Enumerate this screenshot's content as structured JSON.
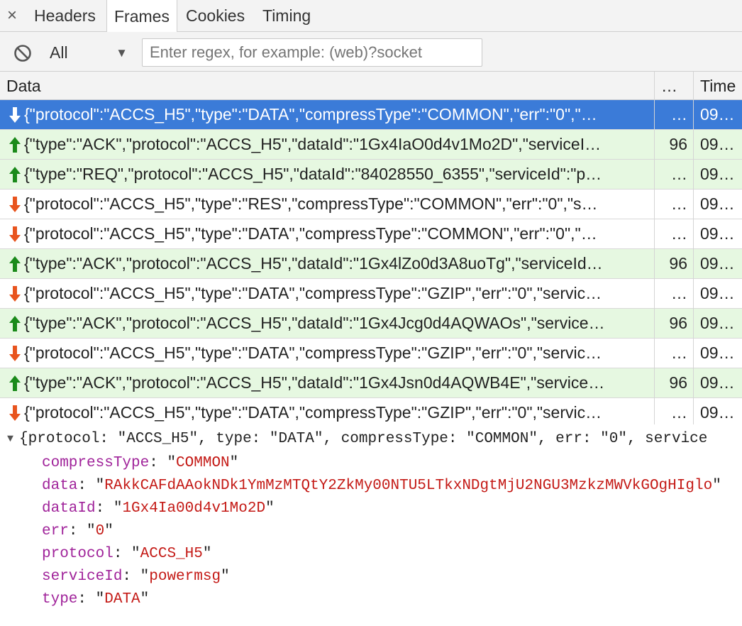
{
  "tabs": {
    "close_glyph": "×",
    "items": [
      {
        "label": "Headers"
      },
      {
        "label": "Frames"
      },
      {
        "label": "Cookies"
      },
      {
        "label": "Timing"
      }
    ]
  },
  "filter": {
    "select_value": "All",
    "regex_placeholder": "Enter regex, for example: (web)?socket"
  },
  "grid": {
    "columns": {
      "data": "Data",
      "length": "…",
      "time": "Time"
    },
    "rows": [
      {
        "dir": "recv",
        "selected": true,
        "data": "{\"protocol\":\"ACCS_H5\",\"type\":\"DATA\",\"compressType\":\"COMMON\",\"err\":\"0\",\"…",
        "length": "…",
        "time": "09…"
      },
      {
        "dir": "sent",
        "selected": false,
        "data": "{\"type\":\"ACK\",\"protocol\":\"ACCS_H5\",\"dataId\":\"1Gx4IaO0d4v1Mo2D\",\"serviceI…",
        "length": "96",
        "time": "09…"
      },
      {
        "dir": "sent",
        "selected": false,
        "data": "{\"type\":\"REQ\",\"protocol\":\"ACCS_H5\",\"dataId\":\"84028550_6355\",\"serviceId\":\"p…",
        "length": "…",
        "time": "09…"
      },
      {
        "dir": "recv",
        "selected": false,
        "data": "{\"protocol\":\"ACCS_H5\",\"type\":\"RES\",\"compressType\":\"COMMON\",\"err\":\"0\",\"s…",
        "length": "…",
        "time": "09…"
      },
      {
        "dir": "recv",
        "selected": false,
        "data": "{\"protocol\":\"ACCS_H5\",\"type\":\"DATA\",\"compressType\":\"COMMON\",\"err\":\"0\",\"…",
        "length": "…",
        "time": "09…"
      },
      {
        "dir": "sent",
        "selected": false,
        "data": "{\"type\":\"ACK\",\"protocol\":\"ACCS_H5\",\"dataId\":\"1Gx4lZo0d3A8uoTg\",\"serviceId…",
        "length": "96",
        "time": "09…"
      },
      {
        "dir": "recv",
        "selected": false,
        "data": "{\"protocol\":\"ACCS_H5\",\"type\":\"DATA\",\"compressType\":\"GZIP\",\"err\":\"0\",\"servic…",
        "length": "…",
        "time": "09…"
      },
      {
        "dir": "sent",
        "selected": false,
        "data": "{\"type\":\"ACK\",\"protocol\":\"ACCS_H5\",\"dataId\":\"1Gx4Jcg0d4AQWAOs\",\"service…",
        "length": "96",
        "time": "09…"
      },
      {
        "dir": "recv",
        "selected": false,
        "data": "{\"protocol\":\"ACCS_H5\",\"type\":\"DATA\",\"compressType\":\"GZIP\",\"err\":\"0\",\"servic…",
        "length": "…",
        "time": "09…"
      },
      {
        "dir": "sent",
        "selected": false,
        "data": "{\"type\":\"ACK\",\"protocol\":\"ACCS_H5\",\"dataId\":\"1Gx4Jsn0d4AQWB4E\",\"service…",
        "length": "96",
        "time": "09…"
      },
      {
        "dir": "recv",
        "selected": false,
        "data": "{\"protocol\":\"ACCS_H5\",\"type\":\"DATA\",\"compressType\":\"GZIP\",\"err\":\"0\",\"servic…",
        "length": "…",
        "time": "09…"
      }
    ]
  },
  "detail": {
    "summary": "{protocol: \"ACCS_H5\", type: \"DATA\", compressType: \"COMMON\", err: \"0\", service",
    "props": [
      {
        "key": "compressType",
        "value": "COMMON"
      },
      {
        "key": "data",
        "value": "RAkkCAFdAAokNDk1YmMzMTQtY2ZkMy00NTU5LTkxNDgtMjU2NGU3MzkzMWVkGOgHIglo"
      },
      {
        "key": "dataId",
        "value": "1Gx4Ia00d4v1Mo2D"
      },
      {
        "key": "err",
        "value": "0"
      },
      {
        "key": "protocol",
        "value": "ACCS_H5"
      },
      {
        "key": "serviceId",
        "value": "powermsg"
      },
      {
        "key": "type",
        "value": "DATA"
      }
    ]
  },
  "colors": {
    "selected_row": "#3b7bd8",
    "sent_row": "#e6f8e1",
    "sent_arrow": "#1a8a1a",
    "recv_arrow": "#e8541e",
    "key_color": "#a0239a",
    "string_color": "#c41a16"
  },
  "icons": {
    "close": "close-icon",
    "block": "block-icon",
    "dropdown": "triangle-down-icon",
    "sent": "arrow-up-icon",
    "recv": "arrow-down-icon",
    "expand": "triangle-expanded-icon"
  }
}
